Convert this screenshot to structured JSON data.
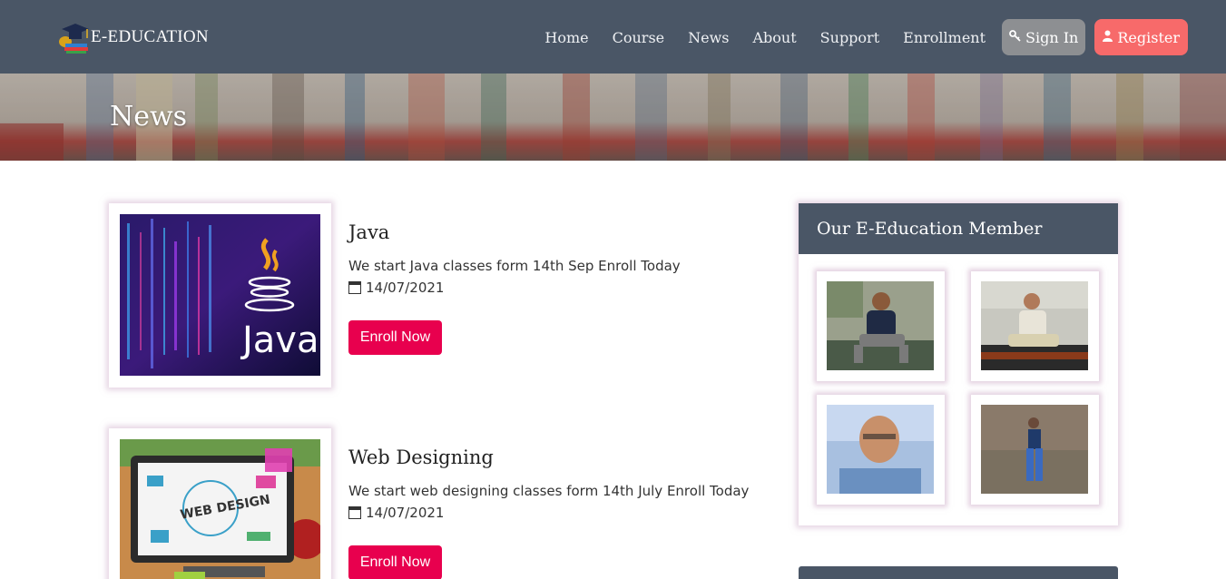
{
  "brand": {
    "name": "E-EDUCATION",
    "logo_icon": "graduation-cap-books-icon"
  },
  "nav": {
    "links": [
      "Home",
      "Course",
      "News",
      "About",
      "Support",
      "Enrollment"
    ],
    "signin_label": "Sign In",
    "signin_icon": "key-icon",
    "register_label": "Register",
    "register_icon": "user-icon"
  },
  "banner": {
    "title": "News"
  },
  "news": [
    {
      "title": "Java",
      "description": "We start Java classes form 14th Sep Enroll Today",
      "date": "14/07/2021",
      "button": "Enroll Now",
      "image": "java-logo"
    },
    {
      "title": "Web Designing",
      "description": "We start web designing classes form 14th July Enroll Today",
      "date": "14/07/2021",
      "button": "Enroll Now",
      "image": "web-design"
    }
  ],
  "sidebar": {
    "title": "Our E-Education Member"
  },
  "colors": {
    "nav_bg": "#4a5666",
    "accent": "#e8004e",
    "register": "#f76a6a",
    "signin": "#8d8f92"
  }
}
